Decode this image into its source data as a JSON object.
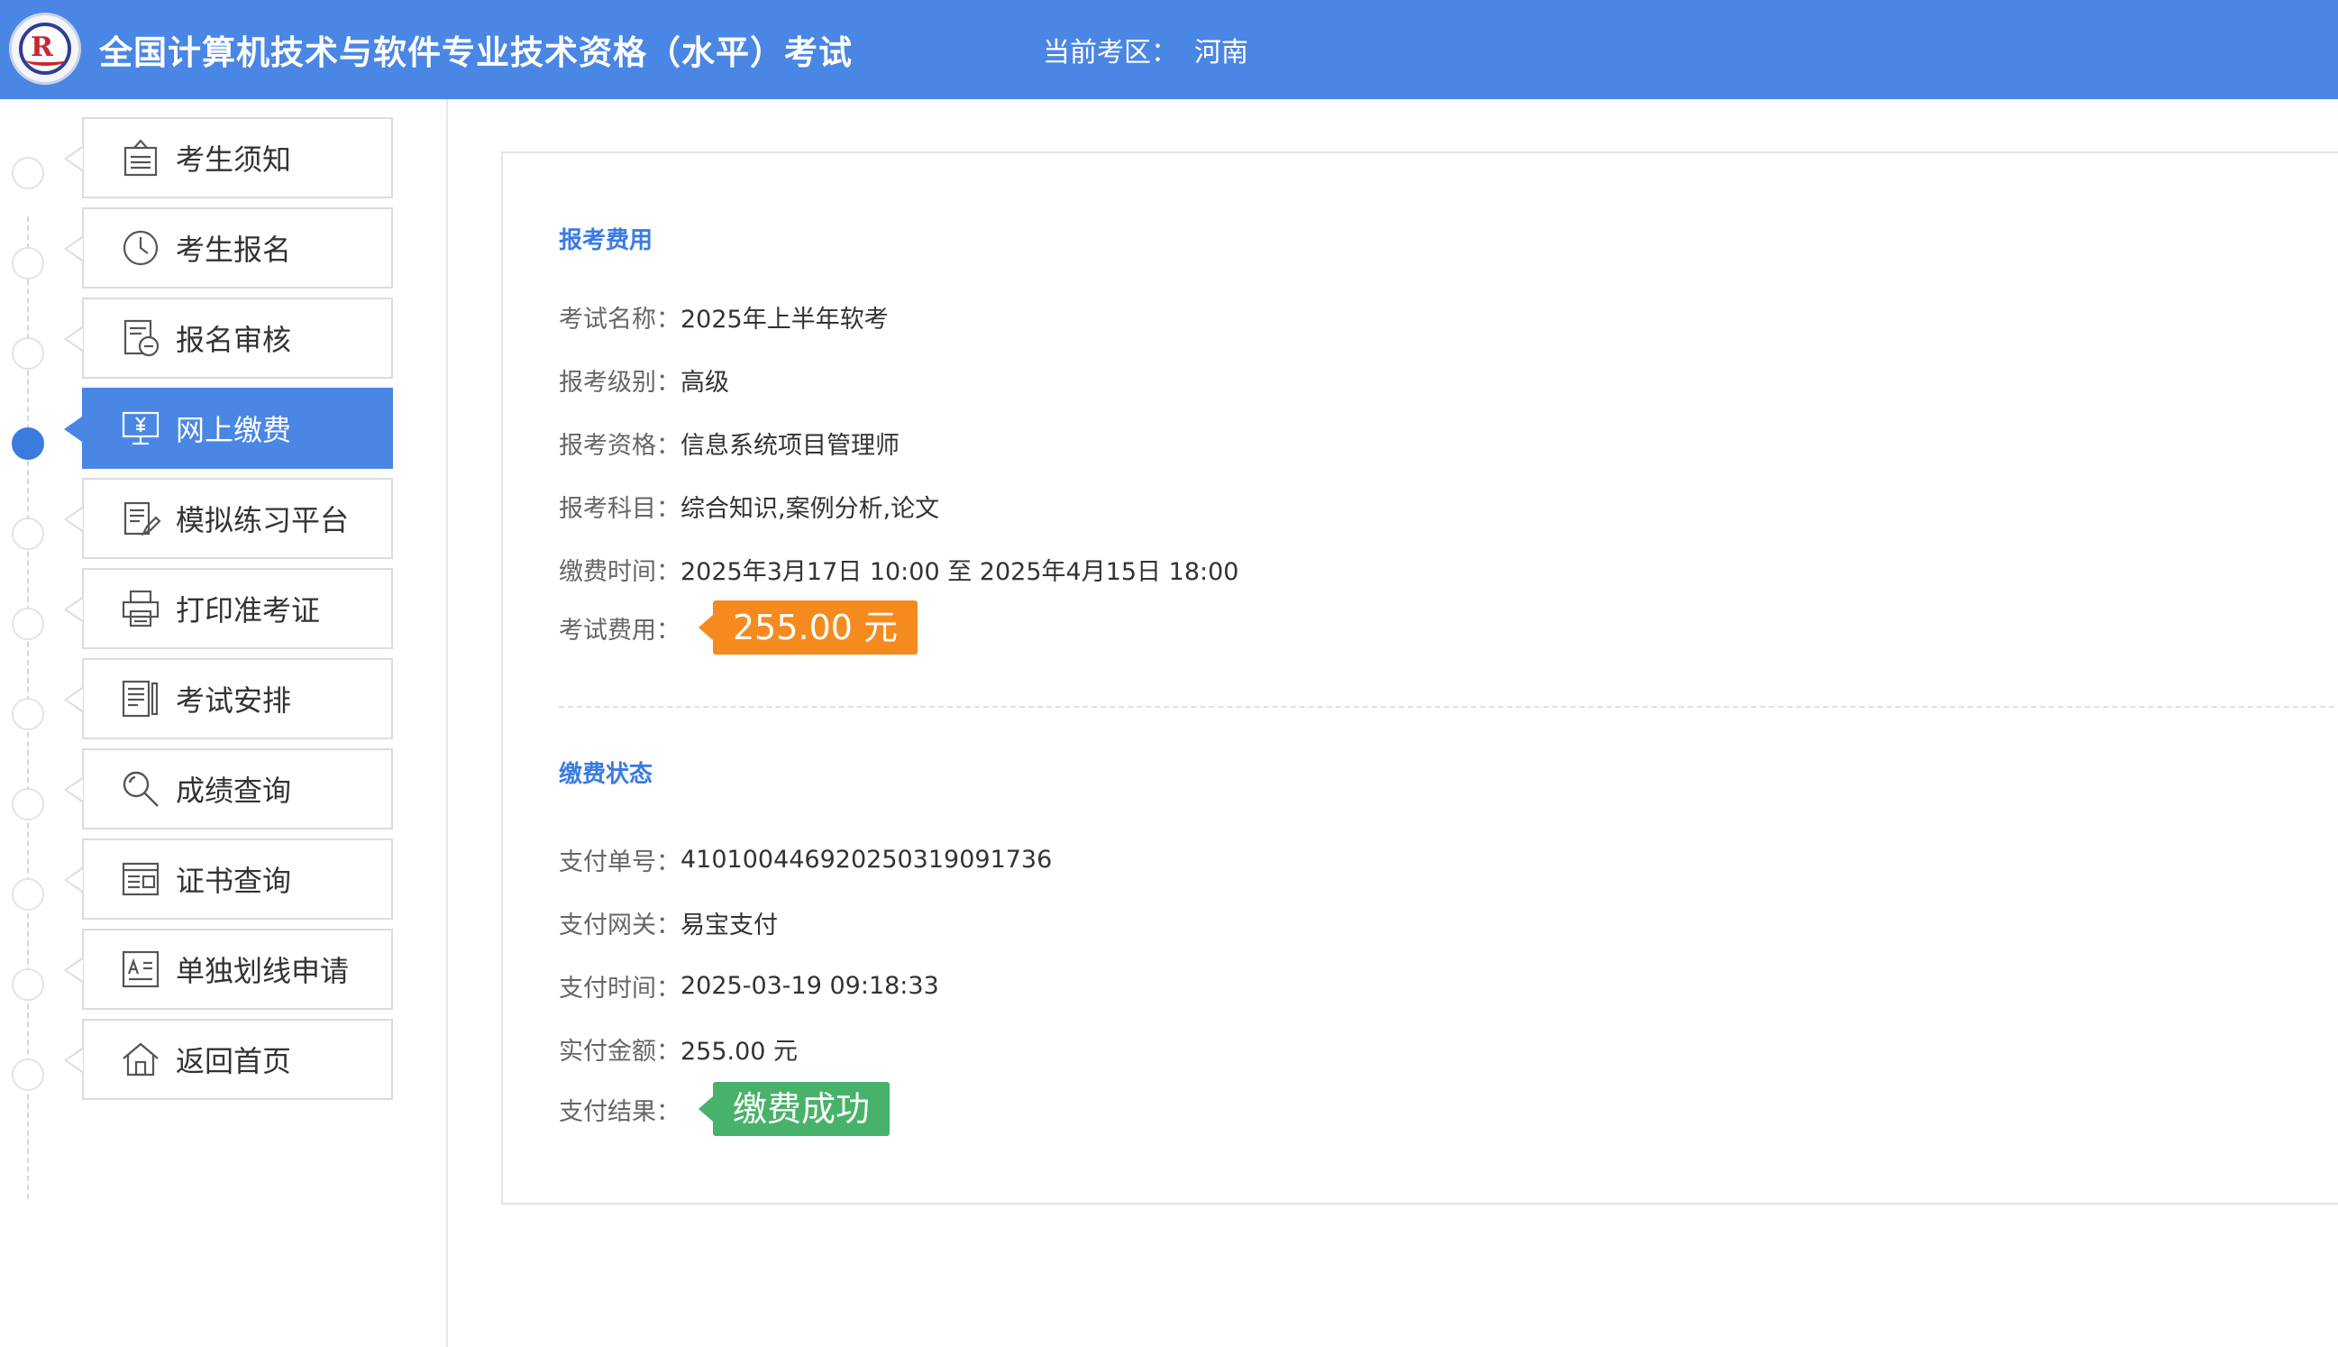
{
  "header": {
    "title": "全国计算机技术与软件专业技术资格（水平）考试",
    "region_label": "当前考区：",
    "region_value": "河南"
  },
  "sidebar": {
    "items": [
      {
        "label": "考生须知",
        "icon": "notice-icon",
        "active": false
      },
      {
        "label": "考生报名",
        "icon": "clock-icon",
        "active": false
      },
      {
        "label": "报名审核",
        "icon": "review-icon",
        "active": false
      },
      {
        "label": "网上缴费",
        "icon": "payment-monitor-icon",
        "active": true
      },
      {
        "label": "模拟练习平台",
        "icon": "practice-edit-icon",
        "active": false
      },
      {
        "label": "打印准考证",
        "icon": "printer-icon",
        "active": false
      },
      {
        "label": "考试安排",
        "icon": "schedule-document-icon",
        "active": false
      },
      {
        "label": "成绩查询",
        "icon": "magnifier-icon",
        "active": false
      },
      {
        "label": "证书查询",
        "icon": "certificate-icon",
        "active": false
      },
      {
        "label": "单独划线申请",
        "icon": "application-form-icon",
        "active": false
      },
      {
        "label": "返回首页",
        "icon": "home-icon",
        "active": false
      }
    ]
  },
  "fee": {
    "title": "报考费用",
    "rows": [
      {
        "label": "考试名称：",
        "value": "2025年上半年软考"
      },
      {
        "label": "报考级别：",
        "value": "高级"
      },
      {
        "label": "报考资格：",
        "value": "信息系统项目管理师"
      },
      {
        "label": "报考科目：",
        "value": "综合知识,案例分析,论文"
      },
      {
        "label": "缴费时间：",
        "value": "2025年3月17日 10:00 至 2025年4月15日 18:00"
      }
    ],
    "cost_label": "考试费用：",
    "cost_value": "255.00 元"
  },
  "status": {
    "title": "缴费状态",
    "rows": [
      {
        "label": "支付单号：",
        "value": "41010044692025031909173​6"
      },
      {
        "label": "支付网关：",
        "value": "易宝支付"
      },
      {
        "label": "支付时间：",
        "value": "2025-03-19 09:18:33"
      },
      {
        "label": "实付金额：",
        "value": "255.00 元"
      }
    ],
    "result_label": "支付结果：",
    "result_value": "缴费成功"
  },
  "colors": {
    "header_bg": "#4a86e4",
    "accent": "#3b7be0",
    "badge_orange": "#f58b1f",
    "badge_green": "#48b26a"
  }
}
